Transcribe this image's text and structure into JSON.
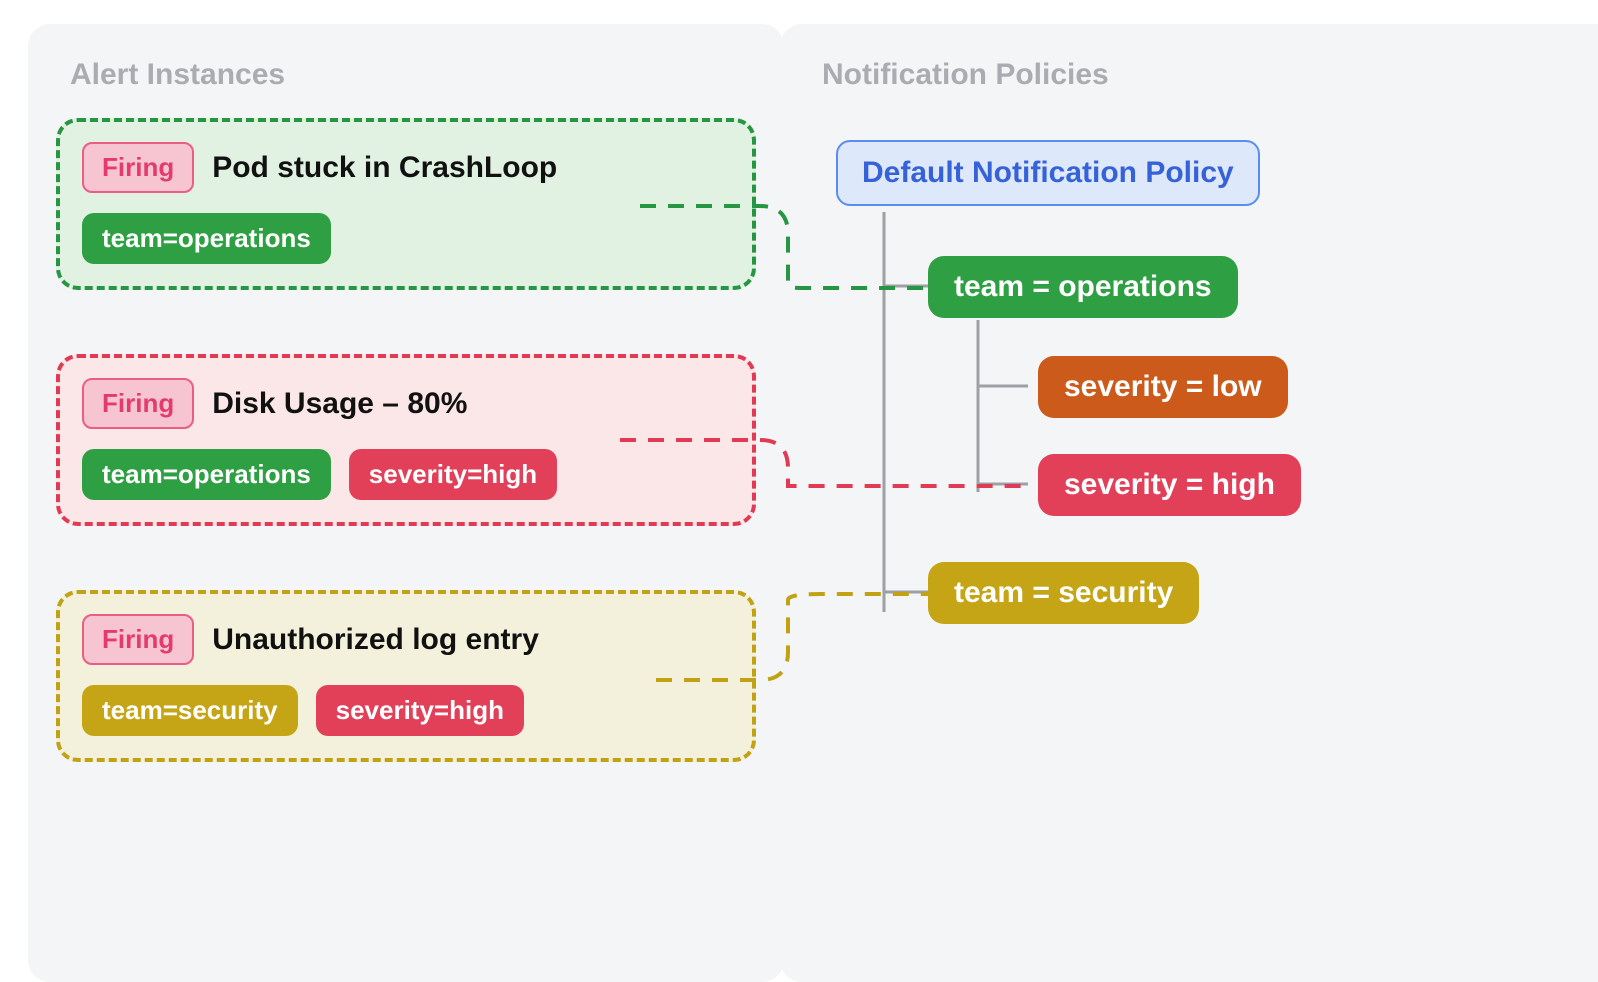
{
  "left": {
    "title": "Alert Instances",
    "alerts": [
      {
        "status": "Firing",
        "name": "Pod stuck in CrashLoop",
        "tags": [
          {
            "text": "team=operations",
            "color": "green"
          }
        ],
        "card_color": "green",
        "routes_to_policy": "team = operations"
      },
      {
        "status": "Firing",
        "name": "Disk Usage – 80%",
        "tags": [
          {
            "text": "team=operations",
            "color": "green"
          },
          {
            "text": "severity=high",
            "color": "red"
          }
        ],
        "card_color": "red",
        "routes_to_policy": "severity = high"
      },
      {
        "status": "Firing",
        "name": "Unauthorized log entry",
        "tags": [
          {
            "text": "team=security",
            "color": "yellow"
          },
          {
            "text": "severity=high",
            "color": "red"
          }
        ],
        "card_color": "yellow",
        "routes_to_policy": "team = security"
      }
    ]
  },
  "right": {
    "title": "Notification Policies",
    "root": "Default Notification Policy",
    "children": [
      {
        "match": "team = operations",
        "color": "green",
        "children": [
          {
            "match": "severity = low",
            "color": "orange"
          },
          {
            "match": "severity = high",
            "color": "red"
          }
        ]
      },
      {
        "match": "team = security",
        "color": "yellow",
        "children": []
      }
    ]
  },
  "colors": {
    "green": "#2ea043",
    "red": "#e24058",
    "yellow": "#c5a515",
    "orange": "#cc5a1a",
    "blue_border": "#5a8dee",
    "blue_bg": "#dee8fb",
    "panel_bg": "#f4f5f6",
    "title_grey": "#a9acb0"
  }
}
